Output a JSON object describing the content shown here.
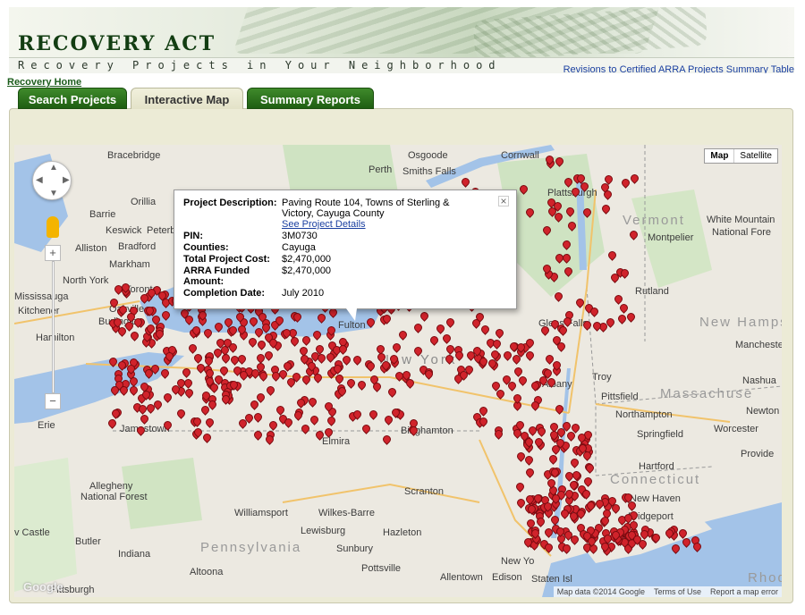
{
  "header": {
    "title": "RECOVERY ACT",
    "subtitle": "Recovery Projects in Your Neighborhood",
    "revisions_link": "Revisions to Certified ARRA Projects Summary Table",
    "home_link": "Recovery Home"
  },
  "tabs": [
    {
      "label": "Search Projects",
      "active": false
    },
    {
      "label": "Interactive Map",
      "active": true
    },
    {
      "label": "Summary Reports",
      "active": false
    }
  ],
  "map_controls": {
    "map_type": [
      "Map",
      "Satellite"
    ],
    "zoom_in": "+",
    "zoom_out": "−"
  },
  "attribution": {
    "data": "Map data ©2014 Google",
    "terms": "Terms of Use",
    "report": "Report a map error",
    "logo": "Google"
  },
  "map_labels": {
    "osgoode": "Osgoode",
    "cornwall": "Cornwall",
    "perth": "Perth",
    "smiths_falls": "Smiths Falls",
    "bracebridge": "Bracebridge",
    "orillia": "Orillia",
    "barrie": "Barrie",
    "keswick": "Keswick",
    "peterborough": "Peterbor",
    "alliston": "Alliston",
    "bradford": "Bradford",
    "markham": "Markham",
    "north_york": "North York",
    "toronto": "Toronto",
    "mississauga": "Mississauga",
    "kitchener": "Kitchener",
    "oakville": "Oakville",
    "burlington": "Burlington",
    "hamilton": "Hamilton",
    "erie": "Erie",
    "jamestown": "Jamestown",
    "elmira": "Elmira",
    "binghamton": "Binghamton",
    "fulton": "Fulton",
    "new_york_state": "New York",
    "plattsburgh": "Plattsburgh",
    "vermont": "Vermont",
    "montpelier": "Montpelier",
    "white_mountain": "White Mountain",
    "national_forest": "National Fore",
    "rutland": "Rutland",
    "new_hampshire": "New Hampshi",
    "manchester": "Manchester",
    "glens_falls": "Glens Falls",
    "albany": "Albany",
    "troy": "Troy",
    "pittsfield": "Pittsfield",
    "massachusetts": "Massachuse",
    "nashua": "Nashua",
    "northampton": "Northampton",
    "newton": "Newton",
    "springfield": "Springfield",
    "worcester": "Worcester",
    "hartford": "Hartford",
    "connecticut": "Connecticut",
    "providence": "Provide",
    "new_haven": "New Haven",
    "bridgeport": "Bridgeport",
    "allegheny": "Allegheny",
    "national_forest2": "National Forest",
    "scranton": "Scranton",
    "williamsport": "Williamsport",
    "wilkes_barre": "Wilkes-Barre",
    "pennsylvania": "Pennsylvania",
    "lewisburg": "Lewisburg",
    "hazleton": "Hazleton",
    "castle": "v Castle",
    "butler": "Butler",
    "sunbury": "Sunbury",
    "indiana": "Indiana",
    "altoona": "Altoona",
    "pottsville": "Pottsville",
    "allentown": "Allentown",
    "new_york_city": "New Yo",
    "edison": "Edison",
    "staten_island": "Staten Isl",
    "pittsburgh": "Pittsburgh",
    "rhode": "Rhod"
  },
  "info_window": {
    "rows": [
      {
        "key": "Project Description:",
        "value": "Paving Route 104, Towns of Sterling & Victory, Cayuga County",
        "link": "See Project Details"
      },
      {
        "key": "PIN:",
        "value": "3M0730"
      },
      {
        "key": "Counties:",
        "value": "Cayuga"
      },
      {
        "key": "Total Project Cost:",
        "value": "$2,470,000"
      },
      {
        "key": "ARRA Funded Amount:",
        "value": "$2,470,000"
      },
      {
        "key": "Completion Date:",
        "value": "July 2010"
      }
    ],
    "close": "×"
  },
  "colors": {
    "tab_green": "#2d7a1f",
    "marker_red": "#d0232b",
    "link_blue": "#1a3fa0",
    "land": "#e9e6df",
    "water": "#a3c3e8"
  }
}
